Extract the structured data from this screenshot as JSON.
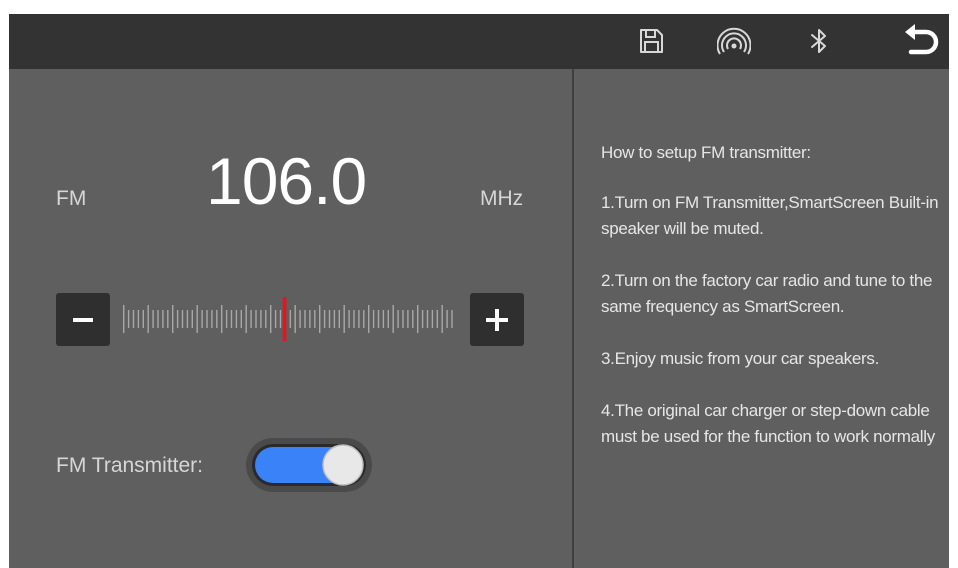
{
  "topbar": {
    "icons": [
      "save-icon",
      "signal-icon",
      "bluetooth-icon",
      "back-icon"
    ]
  },
  "radio": {
    "band": "FM",
    "frequency": "106.0",
    "unit": "MHz",
    "minus_label": "−",
    "plus_label": "+",
    "tuner_position": 0.49
  },
  "transmitter": {
    "label": "FM Transmitter:",
    "enabled": true,
    "on_color": "#3a82f7"
  },
  "help": {
    "title": "How to setup FM transmitter:",
    "steps": [
      "1.Turn on FM Transmitter,SmartScreen Built-in speaker will be muted.",
      "2.Turn on the factory car radio and tune to the same frequency as SmartScreen.",
      "3.Enjoy music from your car speakers.",
      "4.The original car charger or step-down cable must be used for the function to work normally"
    ]
  },
  "colors": {
    "background": "#5f5f5f",
    "topbar": "#333333",
    "needle": "#e0181e",
    "ticks": "#a8a8a8"
  }
}
